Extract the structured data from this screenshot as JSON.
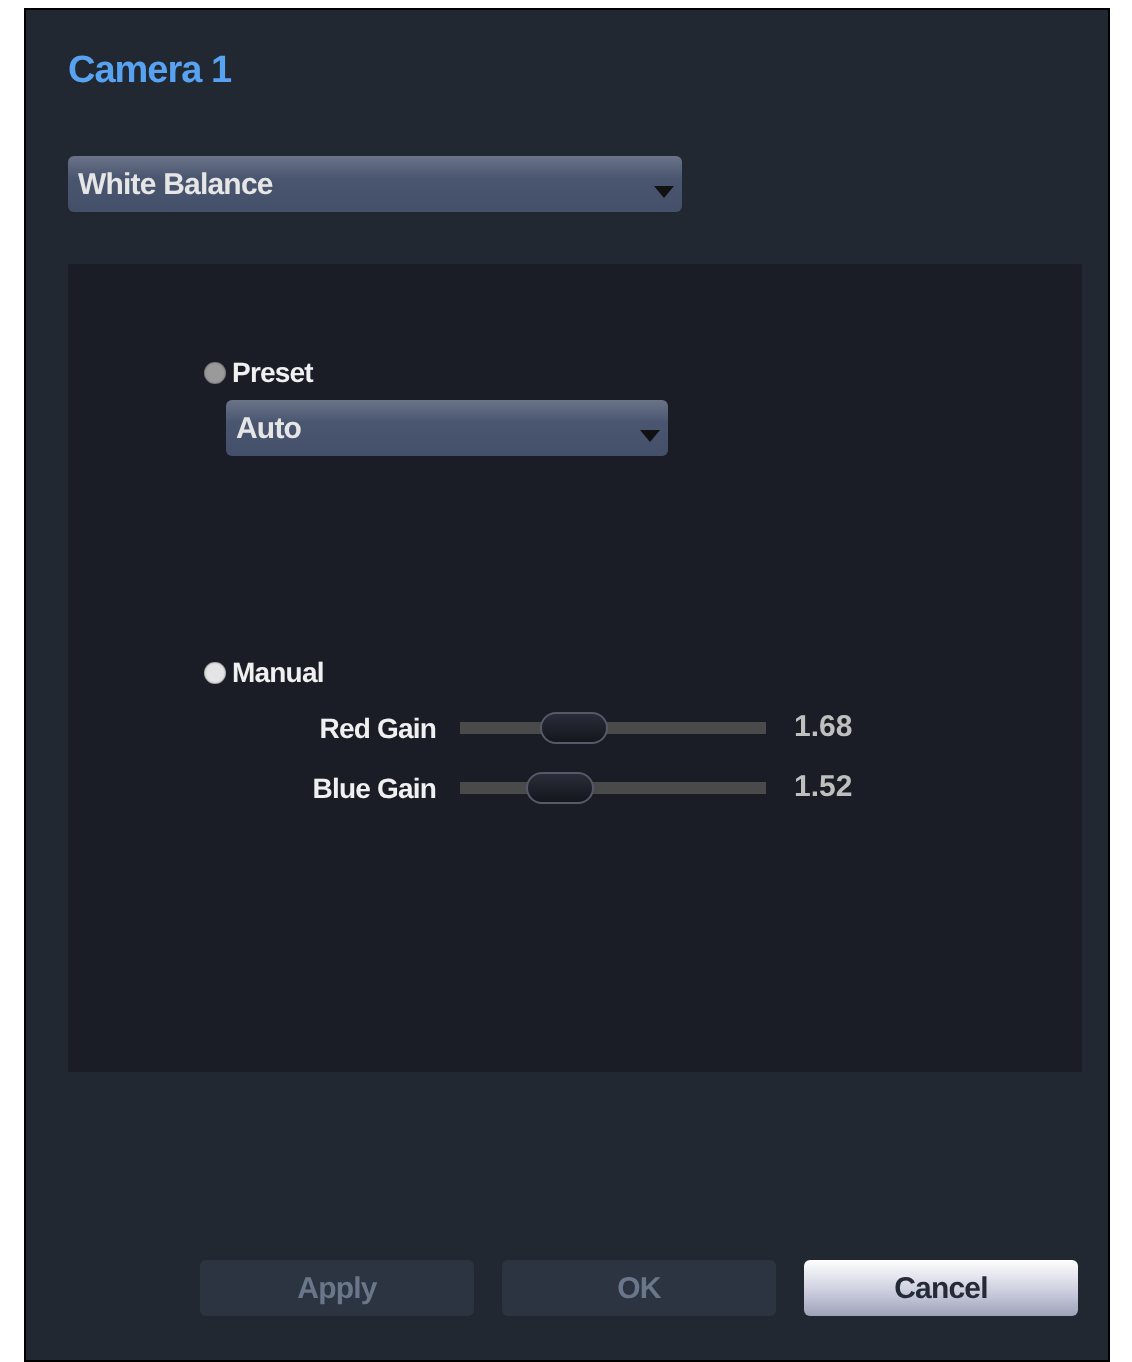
{
  "window": {
    "title": "Camera 1"
  },
  "category_dropdown": {
    "value": "White Balance"
  },
  "modes": [
    {
      "kind": "preset",
      "label": "Preset",
      "selected": false,
      "dropdown": {
        "value": "Auto"
      }
    },
    {
      "kind": "manual",
      "label": "Manual",
      "selected": true,
      "sliders": [
        {
          "label": "Red Gain",
          "level": 0.37,
          "reading": "1.68"
        },
        {
          "label": "Blue Gain",
          "level": 0.33,
          "reading": "1.52"
        }
      ]
    }
  ],
  "buttons": [
    {
      "label": "Apply",
      "disabled": true
    },
    {
      "label": "OK",
      "disabled": true
    },
    {
      "label": "Cancel",
      "disabled": false
    }
  ]
}
